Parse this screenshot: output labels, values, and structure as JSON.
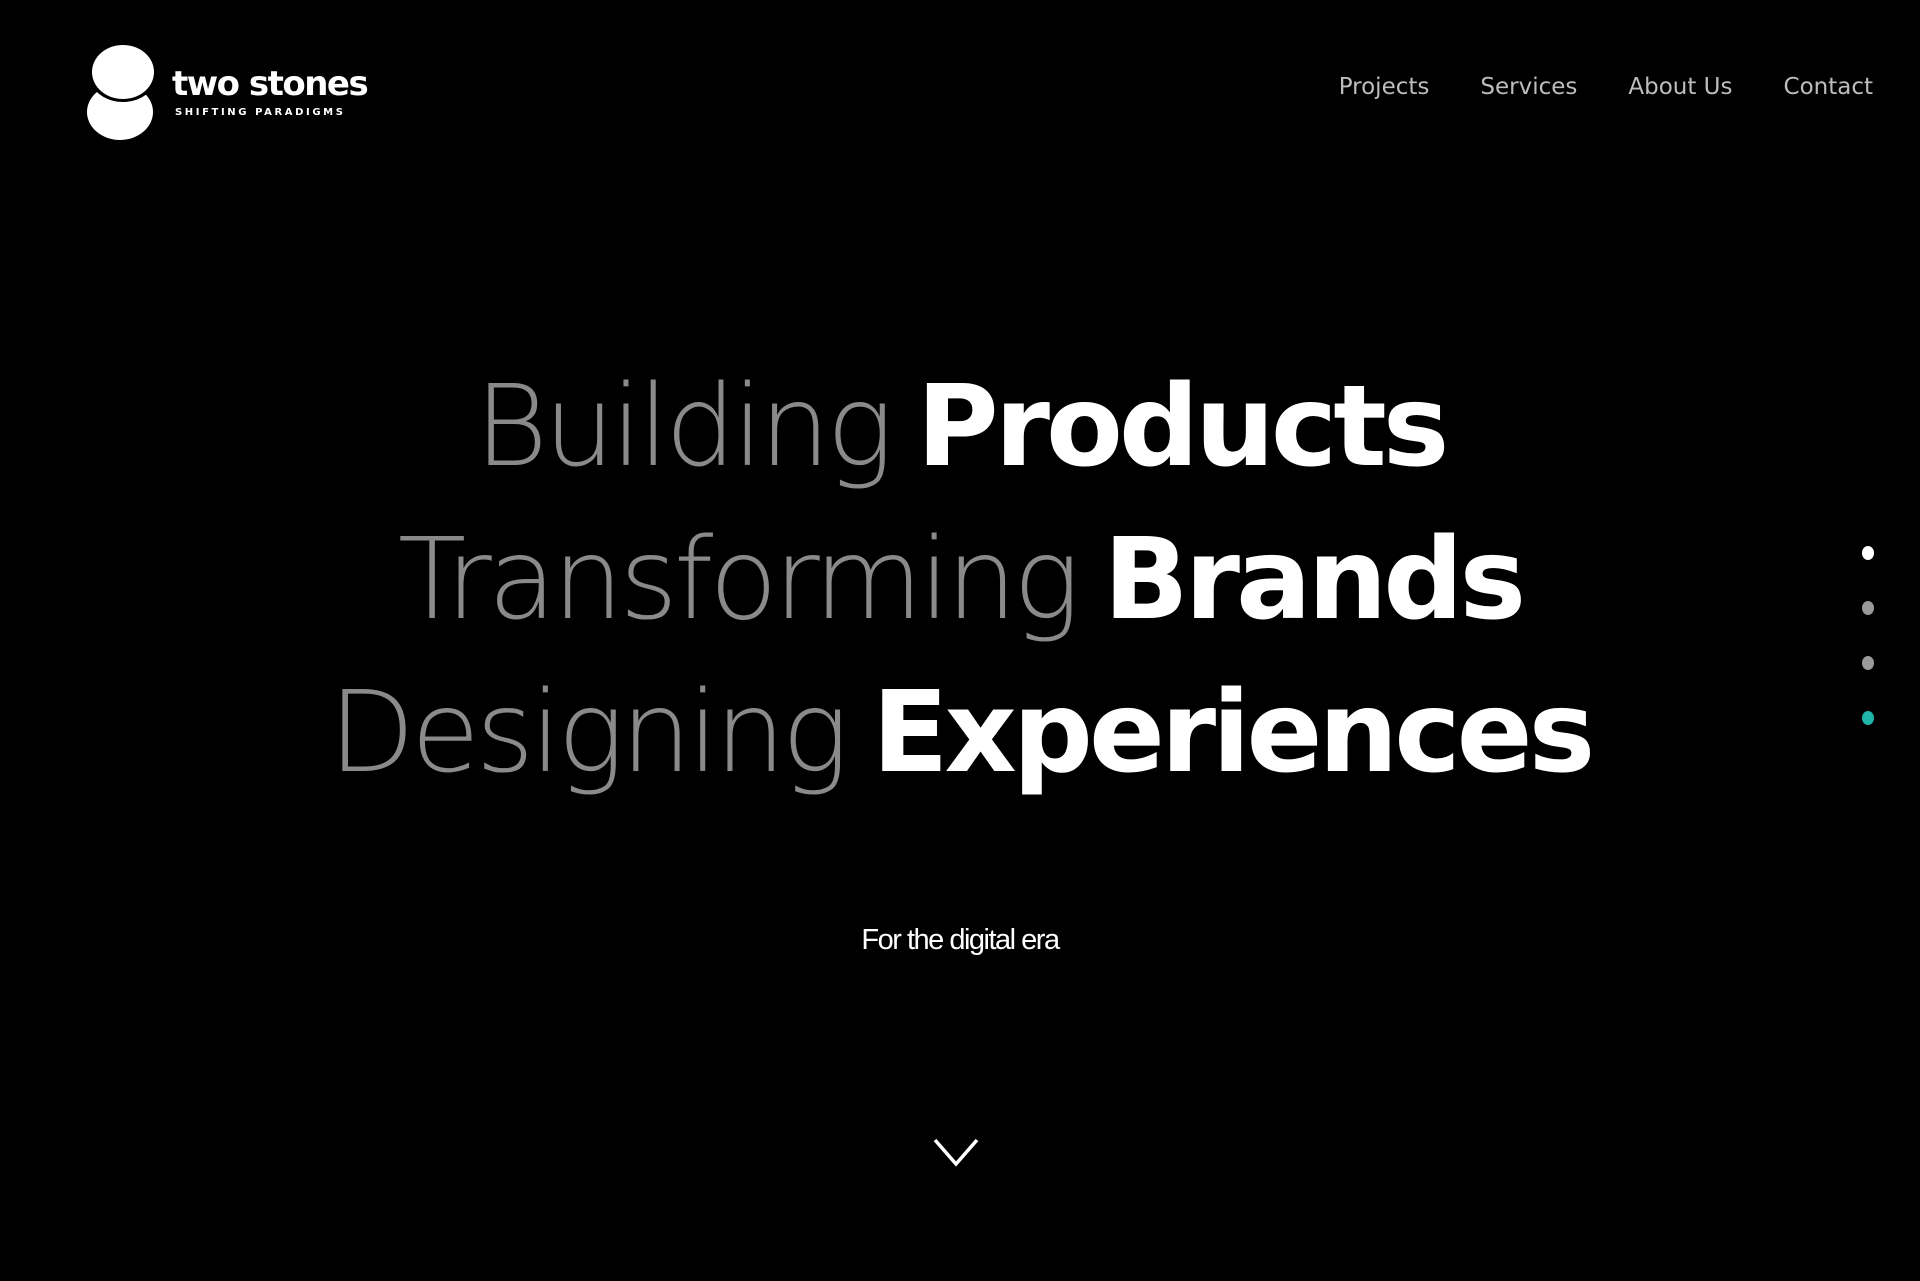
{
  "brand": {
    "name": "two stones",
    "tagline": "SHIFTING PARADIGMS"
  },
  "nav": {
    "items": [
      {
        "label": "Projects"
      },
      {
        "label": "Services"
      },
      {
        "label": "About Us"
      },
      {
        "label": "Contact"
      }
    ]
  },
  "hero": {
    "lines": [
      {
        "light": "Building",
        "bold": "Products"
      },
      {
        "light": "Transforming",
        "bold": "Brands"
      },
      {
        "light": "Designing",
        "bold": "Experiences"
      }
    ],
    "subtitle": "For the digital era"
  },
  "scroll_icon": "chevron-down-icon",
  "pagination": {
    "dots": [
      {
        "color": "#ffffff",
        "active": false
      },
      {
        "color": "#9a9a9a",
        "active": false
      },
      {
        "color": "#9a9a9a",
        "active": false
      },
      {
        "color": "#1fb5a8",
        "active": true
      }
    ]
  },
  "colors": {
    "background": "#000000",
    "nav_text": "#bdbdbd",
    "hero_light": "#8a8a8a",
    "hero_bold": "#ffffff",
    "accent": "#1fb5a8"
  }
}
